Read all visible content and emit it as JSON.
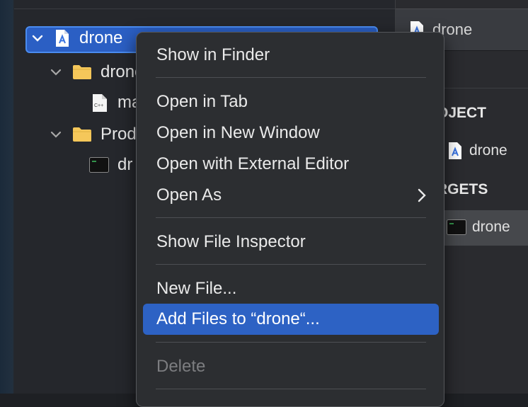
{
  "tree": {
    "project": "drone",
    "folder_drone": "drone",
    "file_main": "ma",
    "folder_products": "Prod",
    "product": "dr"
  },
  "editor": {
    "tab_title": "drone",
    "project_header": "OJECT",
    "project_item": "drone",
    "targets_header": "RGETS",
    "target_item": "drone"
  },
  "menu": {
    "show_in_finder": "Show in Finder",
    "open_in_tab": "Open in Tab",
    "open_in_new_window": "Open in New Window",
    "open_with_external_editor": "Open with External Editor",
    "open_as": "Open As",
    "show_file_inspector": "Show File Inspector",
    "new_file": "New File...",
    "add_files": "Add Files to “drone“...",
    "delete": "Delete"
  },
  "colors": {
    "highlight": "#2d62c4",
    "selection_border": "#4a8cf0",
    "folder": "#f5c75a"
  }
}
